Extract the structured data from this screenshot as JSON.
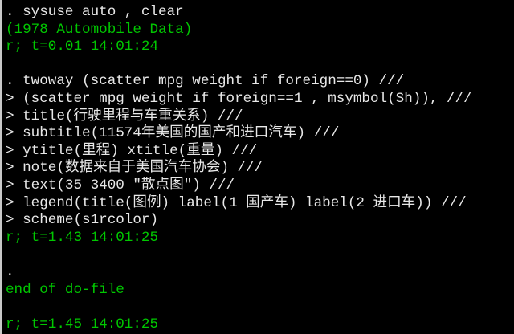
{
  "colors": {
    "background": "#000000",
    "command_text": "#e8e8e8",
    "result_text": "#00c800"
  },
  "lines": [
    {
      "text": ". sysuse auto , clear",
      "kind": "cmd"
    },
    {
      "text": "(1978 Automobile Data)",
      "kind": "res"
    },
    {
      "text": "r; t=0.01 14:01:24",
      "kind": "res"
    },
    {
      "text": "",
      "kind": "cmd"
    },
    {
      "text": ". twoway (scatter mpg weight if foreign==0) ///",
      "kind": "cmd"
    },
    {
      "text": "> (scatter mpg weight if foreign==1 , msymbol(Sh)), ///",
      "kind": "cmd"
    },
    {
      "text": "> title(行驶里程与车重关系) ///",
      "kind": "cmd"
    },
    {
      "text": "> subtitle(11574年美国的国产和进口汽车) ///",
      "kind": "cmd"
    },
    {
      "text": "> ytitle(里程) xtitle(重量) ///",
      "kind": "cmd"
    },
    {
      "text": "> note(数据来自于美国汽车协会) ///",
      "kind": "cmd"
    },
    {
      "text": "> text(35 3400 \"散点图\") ///",
      "kind": "cmd"
    },
    {
      "text": "> legend(title(图例) label(1 国产车) label(2 进口车)) ///",
      "kind": "cmd"
    },
    {
      "text": "> scheme(s1rcolor)",
      "kind": "cmd"
    },
    {
      "text": "r; t=1.43 14:01:25",
      "kind": "res"
    },
    {
      "text": "",
      "kind": "cmd"
    },
    {
      "text": ".",
      "kind": "cmd"
    },
    {
      "text": "end of do-file",
      "kind": "res"
    },
    {
      "text": "",
      "kind": "cmd"
    },
    {
      "text": "r; t=1.45 14:01:25",
      "kind": "res"
    }
  ]
}
